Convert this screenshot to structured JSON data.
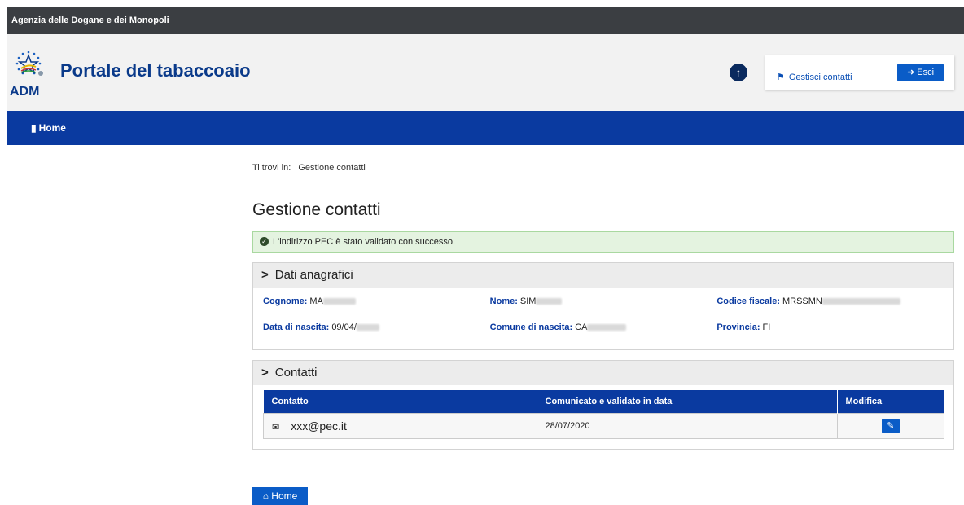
{
  "topbar": {
    "agency": "Agenzia delle Dogane e dei Monopoli"
  },
  "header": {
    "logo_text": "ADM",
    "title": "Portale del tabacco",
    "title_suffix": "aio",
    "gest_label": "Gestisci contatti",
    "esci_label": "Esci"
  },
  "nav": {
    "home_label": "Home"
  },
  "breadcrumb": {
    "prefix": "Ti trovi in:",
    "current": "Gestione contatti"
  },
  "page": {
    "title": "Gestione contatti"
  },
  "alert": {
    "message": "L'indirizzo PEC è stato validato con successo."
  },
  "dati": {
    "title": "Dati anagrafici",
    "cognome_label": "Cognome:",
    "cognome_value": "MA",
    "nome_label": "Nome:",
    "nome_value": "SIM",
    "cf_label": "Codice fiscale:",
    "cf_value": "MRSSMN",
    "nascita_label": "Data di nascita:",
    "nascita_value": "09/04/",
    "comune_label": "Comune di nascita:",
    "comune_value": "CA",
    "provincia_label": "Provincia:",
    "provincia_value": "FI"
  },
  "contatti": {
    "title": "Contatti",
    "columns": [
      "Contatto",
      "Comunicato e validato in data",
      "Modifica"
    ],
    "rows": [
      {
        "contatto": "xxx@pec.it",
        "data": "28/07/2020"
      }
    ]
  },
  "footer": {
    "home_label": "Home"
  },
  "colors": {
    "brand_blue": "#0a3aa0",
    "button_blue": "#0a5cc7",
    "topbar": "#3b3e42",
    "success_bg": "#e4f3e0"
  }
}
